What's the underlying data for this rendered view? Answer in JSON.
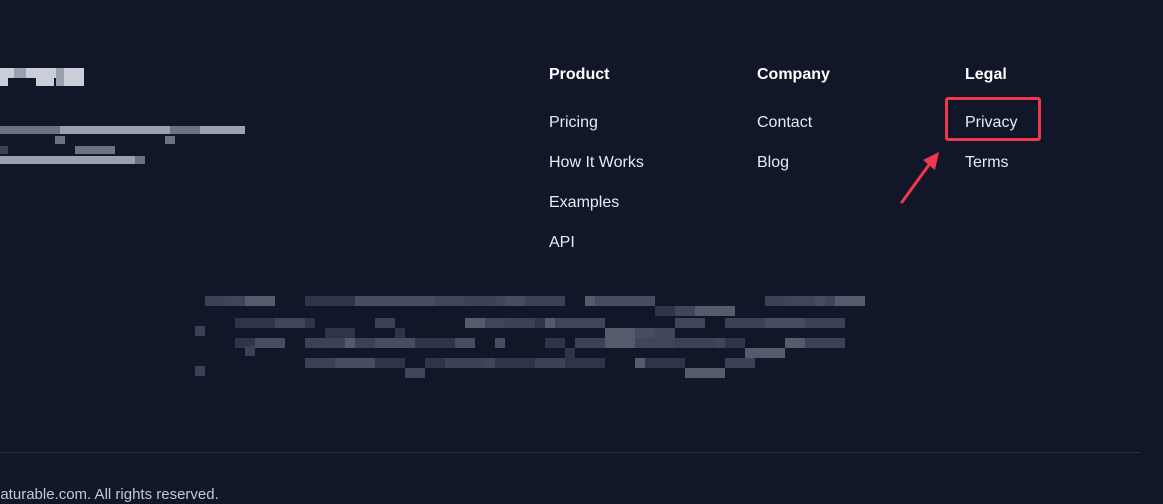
{
  "footer": {
    "columns": [
      {
        "title": "Product",
        "links": [
          "Pricing",
          "How It Works",
          "Examples",
          "API"
        ]
      },
      {
        "title": "Company",
        "links": [
          "Contact",
          "Blog"
        ]
      },
      {
        "title": "Legal",
        "links": [
          "Privacy",
          "Terms"
        ]
      }
    ],
    "copyright": "eaturable.com. All rights reserved."
  },
  "annotation": {
    "highlight_color": "#f0384c",
    "highlighted_link": "Privacy"
  },
  "colors": {
    "background": "#111729",
    "heading": "#ffffff",
    "link": "#e8eaf0",
    "divider": "#2b3245"
  }
}
